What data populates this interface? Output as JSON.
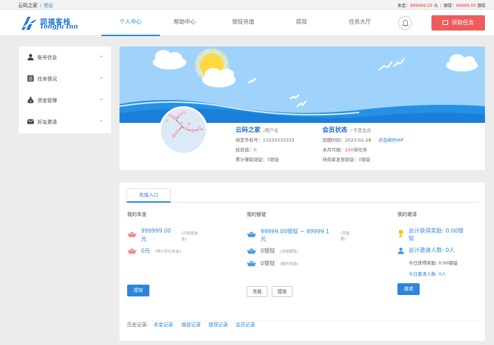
{
  "topbar": {
    "site_name": "云码之家",
    "logout": "退出",
    "principal_label": "本金：",
    "principal_value": "999999.00",
    "principal_unit": "元",
    "ingot_label": "银锭：",
    "ingot_value": "99999.00",
    "ingot_unit": "银锭"
  },
  "header": {
    "logo_cn": "同福客栈",
    "logo_en": "Tongfu Inn",
    "nav": [
      "个人中心",
      "帮助中心",
      "银锭充值",
      "提现",
      "任务大厅"
    ],
    "task_button": "领取任务"
  },
  "sidebar": {
    "items": [
      {
        "label": "账号信息",
        "icon": "user-icon"
      },
      {
        "label": "任务情况",
        "icon": "list-icon"
      },
      {
        "label": "资金管理",
        "icon": "money-bag-icon"
      },
      {
        "label": "好友邀请",
        "icon": "envelope-icon"
      }
    ]
  },
  "profile": {
    "name": "云码之家",
    "role": "/用户名",
    "phone_label": "绑定手机号：",
    "phone": "13333333333",
    "exp_label": "经验值：",
    "exp": "0",
    "withdrawn_label": "累计赚取银锭：",
    "withdrawn": "0银锭",
    "member_title": "会员状态",
    "member_sub": "/ 不是会员",
    "expire_label": "到期时间：",
    "expire": "2023-02-28",
    "renew_link": "点击续时VIP",
    "month_label": "本月可做：",
    "month_count": "220",
    "month_unit": "单任务",
    "pending_label": "待商家发放银锭：",
    "pending": "0银锭"
  },
  "panel": {
    "tab": "充值入口",
    "col1": {
      "title": "我的本金",
      "amount": "999999.00",
      "unit": "元",
      "amount_note1": "(可提现本",
      "amount_note2": "金)",
      "frozen": "0元",
      "frozen_note": "(预计受付本金)",
      "button": "提现"
    },
    "col2": {
      "title": "我的银锭",
      "amount": "99999.00银锭 ~ 89999.1",
      "unit": "元",
      "amount_note1": "(可提",
      "amount_note2": "现)",
      "row2": "0银锭",
      "row2_note": "(冻结银锭)",
      "row3": "0银锭",
      "row3_note": "(额外奖励)",
      "btn_recharge": "充值",
      "btn_convert": "提现"
    },
    "col3": {
      "title": "我的邀请",
      "reward": "总计获得奖励: 0.00银",
      "reward_unit": "锭",
      "invited": "总计邀请人数: 0人",
      "today_reward": "今日获得奖励: 0.00银锭",
      "today_invited": "今日邀请人数: 0人",
      "button": "邀请"
    },
    "history": {
      "label": "历史记录:",
      "links": [
        "本金记录",
        "银锭记录",
        "提现记录",
        "会员记录"
      ]
    }
  },
  "colors": {
    "primary": "#2d86db",
    "danger": "#ef5c5c",
    "sky": "#2b8ee6"
  }
}
